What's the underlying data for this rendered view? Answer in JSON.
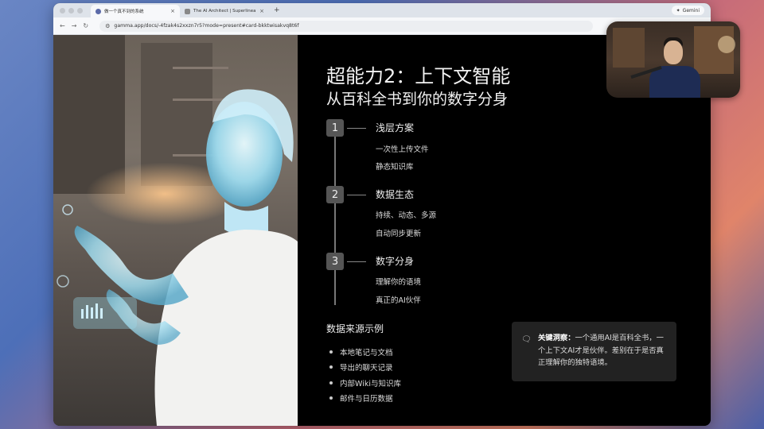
{
  "browser": {
    "tabs": [
      {
        "title": "做一个真不到的系统",
        "active": true
      },
      {
        "title": "The AI Architect | Superlinear",
        "active": false
      }
    ],
    "new_tab": "+",
    "gemini_label": "Gemini",
    "url": "gamma.app/docs/-4fzak4s2xxzn7r5?mode=present#card-bkktwisakvq8t6f"
  },
  "slide": {
    "title": "超能力2：上下文智能",
    "subtitle": "从百科全书到你的数字分身",
    "steps": [
      {
        "num": "1",
        "heading": "浅层方案",
        "items": [
          "一次性上传文件",
          "静态知识库"
        ]
      },
      {
        "num": "2",
        "heading": "数据生态",
        "items": [
          "持续、动态、多源",
          "自动同步更新"
        ]
      },
      {
        "num": "3",
        "heading": "数字分身",
        "items": [
          "理解你的语境",
          "真正的AI伙伴"
        ]
      }
    ],
    "sources_title": "数据来源示例",
    "sources": [
      "本地笔记与文档",
      "导出的聊天记录",
      "内部Wiki与知识库",
      "邮件与日历数据"
    ],
    "insight_label": "关键洞察：",
    "insight_text": "一个通用AI是百科全书，一个上下文AI才是伙伴。差别在于是否真正理解你的独特语境。"
  },
  "colors": {
    "slide_bg": "#000000",
    "badge_bg": "#555555",
    "card_bg": "#222222"
  }
}
